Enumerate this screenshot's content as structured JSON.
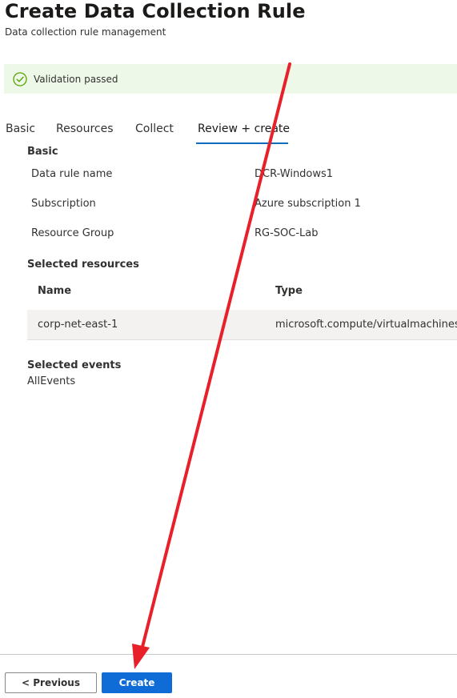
{
  "header": {
    "title": "Create Data Collection Rule",
    "subtitle": "Data collection rule management"
  },
  "validation": {
    "icon": "check-circle-icon",
    "text": "Validation passed",
    "color": "#57a300"
  },
  "tabs": [
    {
      "label": "Basic",
      "active": false
    },
    {
      "label": "Resources",
      "active": false
    },
    {
      "label": "Collect",
      "active": false
    },
    {
      "label": "Review + create",
      "active": true
    }
  ],
  "basic": {
    "heading": "Basic",
    "rows": [
      {
        "label": "Data rule name",
        "value": "DCR-Windows1"
      },
      {
        "label": "Subscription",
        "value": "Azure subscription 1"
      },
      {
        "label": "Resource Group",
        "value": "RG-SOC-Lab"
      }
    ]
  },
  "resources": {
    "heading": "Selected resources",
    "columns": [
      "Name",
      "Type"
    ],
    "rows": [
      {
        "name": "corp-net-east-1",
        "type": "microsoft.compute/virtualmachines"
      }
    ]
  },
  "events": {
    "heading": "Selected events",
    "value": "AllEvents"
  },
  "footer": {
    "previous_label": "< Previous",
    "create_label": "Create"
  },
  "colors": {
    "accent": "#0f6cbd",
    "primary_button": "#0f6cd6",
    "banner_background": "#eef8e8",
    "annotation_arrow": "#e8202a"
  }
}
